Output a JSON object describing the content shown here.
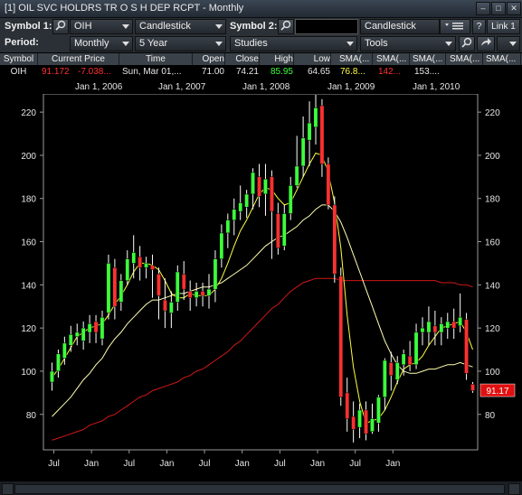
{
  "window": {
    "title": "[1] OIL SVC HOLDRS TR O S H DEP RCPT - Monthly"
  },
  "toolbar1": {
    "symbol1_label": "Symbol 1:",
    "symbol1_value": "OIH",
    "chart_type1": "Candlestick",
    "symbol2_label": "Symbol 2:",
    "symbol2_value": "",
    "chart_type2": "Candlestick",
    "help_label": "?",
    "link_label": "Link 1"
  },
  "toolbar2": {
    "period_label": "Period:",
    "period_value": "Monthly",
    "range_value": "5 Year",
    "studies_value": "Studies",
    "tools_value": "Tools"
  },
  "quote": {
    "headers": [
      "Symbol",
      "Current Price",
      "Time",
      "Open",
      "Close",
      "High",
      "Low",
      "SMA(...",
      "SMA(...",
      "SMA(...",
      "SMA(...",
      "SMA(..."
    ],
    "values": [
      "OIH",
      "91.172",
      "-7.038...",
      "Sun, Mar 01,...",
      "71.00",
      "74.21",
      "85.95",
      "64.65",
      "76.8...",
      "142...",
      "153....",
      "",
      ""
    ],
    "colors": {
      "price": "#ff3030",
      "change": "#ff3030",
      "high": "#3cff3c",
      "sma1": "#ffff40",
      "sma2": "#ff3030",
      "normal": "#e6e6e6"
    }
  },
  "date_labels": [
    "Jan 1, 2006",
    "Jan 1, 2007",
    "Jan 1, 2008",
    "Jan 1, 2009",
    "Jan 1, 2010"
  ],
  "price_tag": "91.17",
  "chart_data": {
    "type": "candlestick",
    "ylim": [
      64,
      228
    ],
    "yticks": [
      80,
      100,
      120,
      140,
      160,
      180,
      200,
      220
    ],
    "x_tick_labels": [
      "Jul",
      "Jan",
      "Jul",
      "Jan",
      "Jul",
      "Jan",
      "Jul",
      "Jan",
      "Jul",
      "Jan"
    ],
    "colors": {
      "up": "#3cff3c",
      "down": "#ff3030",
      "sma_fast": "#ffff40",
      "sma_mid": "#ffffb0",
      "sma_slow": "#d01818"
    },
    "candles": [
      {
        "o": 95,
        "c": 100,
        "h": 104,
        "l": 91
      },
      {
        "o": 100,
        "c": 108,
        "h": 110,
        "l": 97
      },
      {
        "o": 106,
        "c": 113,
        "h": 116,
        "l": 103
      },
      {
        "o": 112,
        "c": 117,
        "h": 121,
        "l": 109
      },
      {
        "o": 116,
        "c": 118,
        "h": 122,
        "l": 112
      },
      {
        "o": 114,
        "c": 120,
        "h": 123,
        "l": 110
      },
      {
        "o": 118,
        "c": 122,
        "h": 126,
        "l": 113
      },
      {
        "o": 123,
        "c": 118,
        "h": 126,
        "l": 113
      },
      {
        "o": 115,
        "c": 125,
        "h": 128,
        "l": 112
      },
      {
        "o": 127,
        "c": 150,
        "h": 154,
        "l": 124
      },
      {
        "o": 148,
        "c": 130,
        "h": 152,
        "l": 124
      },
      {
        "o": 132,
        "c": 142,
        "h": 145,
        "l": 128
      },
      {
        "o": 142,
        "c": 152,
        "h": 156,
        "l": 140
      },
      {
        "o": 150,
        "c": 155,
        "h": 163,
        "l": 143
      },
      {
        "o": 153,
        "c": 148,
        "h": 158,
        "l": 142
      },
      {
        "o": 148,
        "c": 150,
        "h": 153,
        "l": 143
      },
      {
        "o": 149,
        "c": 147,
        "h": 154,
        "l": 134
      },
      {
        "o": 145,
        "c": 135,
        "h": 148,
        "l": 124
      },
      {
        "o": 133,
        "c": 128,
        "h": 143,
        "l": 120
      },
      {
        "o": 127,
        "c": 132,
        "h": 137,
        "l": 120
      },
      {
        "o": 132,
        "c": 146,
        "h": 149,
        "l": 128
      },
      {
        "o": 145,
        "c": 138,
        "h": 151,
        "l": 133
      },
      {
        "o": 137,
        "c": 134,
        "h": 142,
        "l": 128
      },
      {
        "o": 134,
        "c": 137,
        "h": 141,
        "l": 130
      },
      {
        "o": 137,
        "c": 135,
        "h": 141,
        "l": 130
      },
      {
        "o": 135,
        "c": 138,
        "h": 145,
        "l": 129
      },
      {
        "o": 138,
        "c": 152,
        "h": 156,
        "l": 132
      },
      {
        "o": 152,
        "c": 164,
        "h": 168,
        "l": 148
      },
      {
        "o": 164,
        "c": 170,
        "h": 173,
        "l": 157
      },
      {
        "o": 170,
        "c": 175,
        "h": 180,
        "l": 163
      },
      {
        "o": 174,
        "c": 178,
        "h": 186,
        "l": 170
      },
      {
        "o": 176,
        "c": 182,
        "h": 184,
        "l": 171
      },
      {
        "o": 182,
        "c": 192,
        "h": 194,
        "l": 175
      },
      {
        "o": 190,
        "c": 181,
        "h": 196,
        "l": 176
      },
      {
        "o": 182,
        "c": 189,
        "h": 196,
        "l": 172
      },
      {
        "o": 190,
        "c": 174,
        "h": 193,
        "l": 152
      },
      {
        "o": 173,
        "c": 157,
        "h": 178,
        "l": 154
      },
      {
        "o": 158,
        "c": 173,
        "h": 177,
        "l": 156
      },
      {
        "o": 173,
        "c": 186,
        "h": 190,
        "l": 170
      },
      {
        "o": 186,
        "c": 195,
        "h": 209,
        "l": 185
      },
      {
        "o": 195,
        "c": 208,
        "h": 218,
        "l": 190
      },
      {
        "o": 207,
        "c": 215,
        "h": 225,
        "l": 195
      },
      {
        "o": 213,
        "c": 222,
        "h": 228,
        "l": 205
      },
      {
        "o": 223,
        "c": 196,
        "h": 226,
        "l": 190
      },
      {
        "o": 196,
        "c": 177,
        "h": 199,
        "l": 175
      },
      {
        "o": 177,
        "c": 145,
        "h": 181,
        "l": 141
      },
      {
        "o": 144,
        "c": 88,
        "h": 148,
        "l": 84
      },
      {
        "o": 90,
        "c": 78,
        "h": 97,
        "l": 72
      },
      {
        "o": 79,
        "c": 73,
        "h": 86,
        "l": 67
      },
      {
        "o": 74,
        "c": 82,
        "h": 85,
        "l": 69
      },
      {
        "o": 82,
        "c": 71,
        "h": 86,
        "l": 68
      },
      {
        "o": 72,
        "c": 78,
        "h": 85,
        "l": 71
      },
      {
        "o": 76,
        "c": 88,
        "h": 89,
        "l": 72
      },
      {
        "o": 88,
        "c": 105,
        "h": 106,
        "l": 82
      },
      {
        "o": 104,
        "c": 98,
        "h": 109,
        "l": 91
      },
      {
        "o": 96,
        "c": 104,
        "h": 107,
        "l": 94
      },
      {
        "o": 103,
        "c": 108,
        "h": 110,
        "l": 98
      },
      {
        "o": 107,
        "c": 103,
        "h": 114,
        "l": 100
      },
      {
        "o": 103,
        "c": 118,
        "h": 122,
        "l": 101
      },
      {
        "o": 118,
        "c": 120,
        "h": 125,
        "l": 112
      },
      {
        "o": 118,
        "c": 123,
        "h": 130,
        "l": 112
      },
      {
        "o": 121,
        "c": 118,
        "h": 128,
        "l": 112
      },
      {
        "o": 118,
        "c": 122,
        "h": 125,
        "l": 112
      },
      {
        "o": 120,
        "c": 123,
        "h": 127,
        "l": 115
      },
      {
        "o": 123,
        "c": 120,
        "h": 129,
        "l": 115
      },
      {
        "o": 121,
        "c": 125,
        "h": 136,
        "l": 118
      },
      {
        "o": 124,
        "c": 99,
        "h": 127,
        "l": 96
      },
      {
        "o": 94,
        "c": 91,
        "h": 95,
        "l": 90
      }
    ],
    "sma_fast": [
      97,
      101,
      106,
      111,
      116,
      118,
      120,
      121,
      122,
      126,
      131,
      135,
      140,
      146,
      150,
      150,
      149,
      147,
      142,
      136,
      134,
      134,
      136,
      135,
      135,
      135,
      138,
      143,
      150,
      158,
      165,
      170,
      176,
      182,
      185,
      184,
      180,
      177,
      178,
      184,
      190,
      196,
      201,
      200,
      192,
      178,
      157,
      126,
      102,
      86,
      76,
      77,
      78,
      82,
      88,
      95,
      101,
      103,
      104,
      107,
      112,
      116,
      120,
      121,
      122,
      123,
      118,
      110
    ],
    "sma_mid": [
      79,
      82,
      85,
      88,
      92,
      96,
      99,
      103,
      106,
      111,
      115,
      118,
      122,
      125,
      128,
      131,
      133,
      133,
      134,
      135,
      136,
      136,
      137,
      138,
      139,
      139,
      140,
      141,
      143,
      145,
      147,
      149,
      152,
      155,
      158,
      160,
      162,
      163,
      165,
      167,
      170,
      172,
      175,
      177,
      177,
      174,
      169,
      162,
      154,
      146,
      138,
      130,
      122,
      114,
      108,
      103,
      100,
      99,
      99,
      100,
      101,
      101,
      102,
      103,
      103,
      104,
      103,
      102
    ],
    "sma_slow": [
      68,
      69,
      70,
      71,
      72,
      73,
      75,
      76,
      77,
      79,
      80,
      82,
      84,
      86,
      88,
      89,
      91,
      92,
      93,
      94,
      95,
      97,
      98,
      100,
      101,
      103,
      105,
      107,
      109,
      112,
      114,
      117,
      120,
      123,
      126,
      129,
      131,
      134,
      137,
      139,
      141,
      142,
      143,
      143,
      143,
      143,
      142,
      142,
      142,
      142,
      142,
      142,
      142,
      142,
      142,
      142,
      142,
      142,
      142,
      142,
      142,
      142,
      141,
      141,
      141,
      140,
      140,
      139
    ]
  }
}
